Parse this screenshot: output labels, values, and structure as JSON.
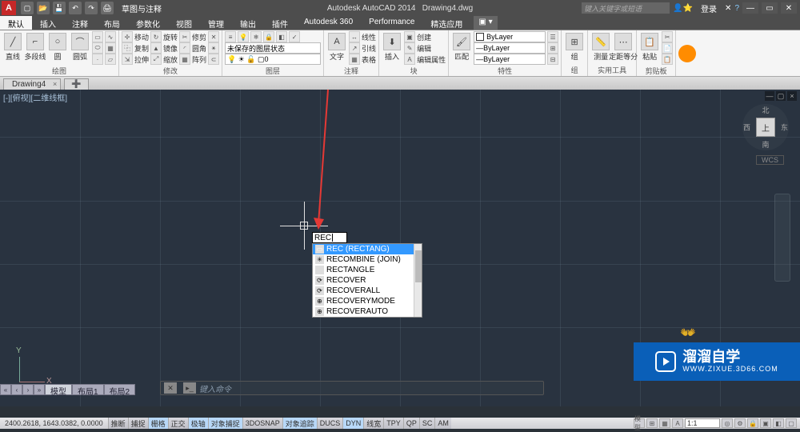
{
  "title": {
    "app": "Autodesk AutoCAD 2014",
    "file": "Drawing4.dwg"
  },
  "qat_workspace": "草图与注释",
  "search_placeholder": "键入关键字或短语",
  "login_label": "登录",
  "tabs": [
    "默认",
    "插入",
    "注释",
    "布局",
    "参数化",
    "视图",
    "管理",
    "输出",
    "插件",
    "Autodesk 360",
    "Performance",
    "精选应用"
  ],
  "ribbon": {
    "draw": {
      "label": "绘图",
      "line": "直线",
      "polyline": "多段线",
      "circle": "圆",
      "arc": "圆弧"
    },
    "modify": {
      "label": "修改",
      "move": "移动",
      "rotate": "旋转",
      "trim": "修剪",
      "copy": "复制",
      "mirror": "镜像",
      "fillet": "圆角",
      "stretch": "拉伸",
      "scale": "缩放",
      "array": "阵列"
    },
    "layer": {
      "label": "图层",
      "state": "未保存的图层状态",
      "cur": "0"
    },
    "annot": {
      "label": "注释",
      "text": "文字",
      "linetype": "线性",
      "leader": "引线",
      "table": "表格"
    },
    "block": {
      "label": "块",
      "insert": "插入",
      "create": "创建",
      "edit": "编辑",
      "editattr": "编辑属性"
    },
    "props": {
      "label": "特性",
      "bylayer": "ByLayer",
      "match": "匹配"
    },
    "group": {
      "label": "组",
      "group_btn": "组"
    },
    "util": {
      "label": "实用工具",
      "measure": "测量",
      "dist": "定距等分"
    },
    "clip": {
      "label": "剪贴板",
      "paste": "粘贴"
    }
  },
  "file_tab": "Drawing4",
  "viewport_label": "[-][俯视][二维线框]",
  "viewcube": {
    "top": "上",
    "n": "北",
    "s": "南",
    "e": "东",
    "w": "西",
    "wcs": "WCS"
  },
  "cmd_typed": "REC",
  "autocomplete": [
    "REC (RECTANG)",
    "RECOMBINE (JOIN)",
    "RECTANGLE",
    "RECOVER",
    "RECOVERALL",
    "RECOVERYMODE",
    "RECOVERAUTO"
  ],
  "cmdline_prompt": "键入命令",
  "model_tabs": {
    "model": "模型",
    "layout1": "布局1",
    "layout2": "布局2"
  },
  "status": {
    "coords": "2400.2618, 1643.0382, 0.0000",
    "buttons": [
      "推断",
      "捕捉",
      "栅格",
      "正交",
      "极轴",
      "对象捕捉",
      "3DOSNAP",
      "对象追踪",
      "DUCS",
      "DYN",
      "线宽",
      "TPY",
      "QP",
      "SC",
      "AM"
    ],
    "scale": "1:1"
  },
  "watermark": {
    "brand": "溜溜自学",
    "url": "WWW.ZIXUE.3D66.COM"
  }
}
